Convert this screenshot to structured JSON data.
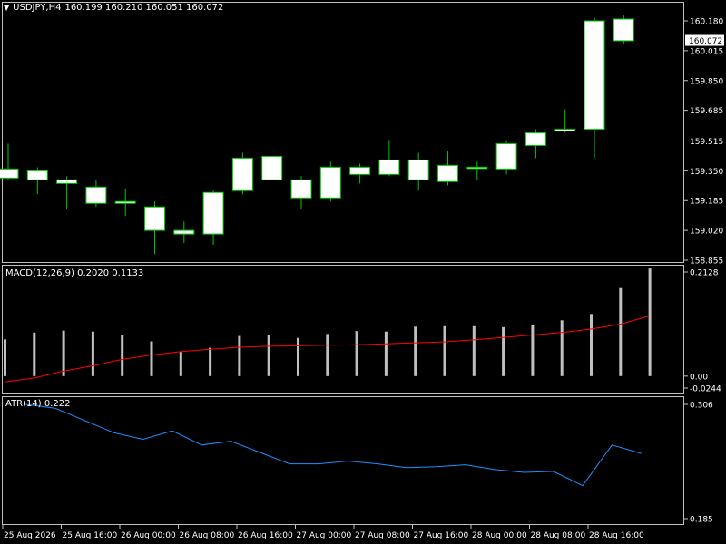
{
  "header": {
    "symbol": "USDJPY,H4",
    "ohlc": "160.199 160.210 160.051 160.072"
  },
  "colors": {
    "background": "#000000",
    "frame": "#c0c0c0",
    "candle_outline": "#00c800",
    "candle_up_fill": "#ffffff",
    "candle_down_fill": "#ffffff",
    "macd_histogram": "#c0c0c0",
    "macd_signal": "#ff0000",
    "atr_line": "#1e90ff",
    "current_price_bg": "#ffffff",
    "current_price_text": "#000000"
  },
  "chart_data": [
    {
      "type": "candlestick",
      "panel": "price",
      "symbol": "USDJPY",
      "timeframe": "H4",
      "current_price": "160.072",
      "ylim": [
        158.855,
        160.25
      ],
      "ytick_labels": [
        "160.180",
        "160.015",
        "159.850",
        "159.685",
        "159.515",
        "159.350",
        "159.185",
        "159.020",
        "158.855"
      ],
      "candles": [
        {
          "o": 159.36,
          "h": 159.5,
          "l": 159.3,
          "c": 159.31
        },
        {
          "o": 159.35,
          "h": 159.37,
          "l": 159.22,
          "c": 159.3
        },
        {
          "o": 159.3,
          "h": 159.32,
          "l": 159.14,
          "c": 159.28
        },
        {
          "o": 159.26,
          "h": 159.3,
          "l": 159.15,
          "c": 159.17
        },
        {
          "o": 159.18,
          "h": 159.25,
          "l": 159.1,
          "c": 159.17
        },
        {
          "o": 159.15,
          "h": 159.18,
          "l": 158.89,
          "c": 159.02
        },
        {
          "o": 159.0,
          "h": 159.07,
          "l": 158.95,
          "c": 159.02
        },
        {
          "o": 159.0,
          "h": 159.24,
          "l": 158.94,
          "c": 159.23
        },
        {
          "o": 159.24,
          "h": 159.45,
          "l": 159.22,
          "c": 159.42
        },
        {
          "o": 159.43,
          "h": 159.43,
          "l": 159.3,
          "c": 159.3
        },
        {
          "o": 159.3,
          "h": 159.32,
          "l": 159.14,
          "c": 159.2
        },
        {
          "o": 159.2,
          "h": 159.4,
          "l": 159.18,
          "c": 159.37
        },
        {
          "o": 159.33,
          "h": 159.39,
          "l": 159.28,
          "c": 159.37
        },
        {
          "o": 159.33,
          "h": 159.52,
          "l": 159.32,
          "c": 159.41
        },
        {
          "o": 159.41,
          "h": 159.45,
          "l": 159.24,
          "c": 159.3
        },
        {
          "o": 159.29,
          "h": 159.46,
          "l": 159.27,
          "c": 159.38
        },
        {
          "o": 159.37,
          "h": 159.4,
          "l": 159.3,
          "c": 159.37
        },
        {
          "o": 159.36,
          "h": 159.52,
          "l": 159.33,
          "c": 159.5
        },
        {
          "o": 159.49,
          "h": 159.58,
          "l": 159.42,
          "c": 159.56
        },
        {
          "o": 159.57,
          "h": 159.69,
          "l": 159.56,
          "c": 159.58
        },
        {
          "o": 159.58,
          "h": 160.2,
          "l": 159.42,
          "c": 160.18
        },
        {
          "o": 160.19,
          "h": 160.21,
          "l": 160.05,
          "c": 160.07
        }
      ]
    },
    {
      "type": "bar",
      "panel": "macd",
      "label": "MACD(12,26,9) 0.2020 0.1133",
      "ylim": [
        -0.0244,
        0.2128
      ],
      "ytick_labels": [
        "0.2128",
        "0.00",
        "-0.0244"
      ],
      "histogram": [
        0.075,
        0.089,
        0.093,
        0.091,
        0.084,
        0.071,
        0.05,
        0.058,
        0.082,
        0.085,
        0.078,
        0.086,
        0.092,
        0.091,
        0.101,
        0.102,
        0.102,
        0.1,
        0.104,
        0.114,
        0.127,
        0.18,
        0.22
      ],
      "signal": [
        -0.012,
        -0.004,
        0.01,
        0.021,
        0.034,
        0.043,
        0.05,
        0.055,
        0.059,
        0.061,
        0.062,
        0.063,
        0.064,
        0.066,
        0.068,
        0.07,
        0.074,
        0.079,
        0.084,
        0.089,
        0.096,
        0.106,
        0.123
      ]
    },
    {
      "type": "line",
      "panel": "atr",
      "label": "ATR(14) 0.222",
      "ylim": [
        0.185,
        0.306
      ],
      "ytick_labels": [
        "0.306",
        "0.185"
      ],
      "values": [
        0.306,
        0.302,
        0.289,
        0.276,
        0.269,
        0.278,
        0.263,
        0.267,
        0.255,
        0.243,
        0.243,
        0.246,
        0.243,
        0.239,
        0.24,
        0.242,
        0.237,
        0.234,
        0.235,
        0.22,
        0.263,
        0.254
      ]
    }
  ],
  "time_axis": [
    "25 Aug 2026",
    "25 Aug 16:00",
    "26 Aug 00:00",
    "26 Aug 08:00",
    "26 Aug 16:00",
    "27 Aug 00:00",
    "27 Aug 08:00",
    "27 Aug 16:00",
    "28 Aug 00:00",
    "28 Aug 08:00",
    "28 Aug 16:00"
  ]
}
